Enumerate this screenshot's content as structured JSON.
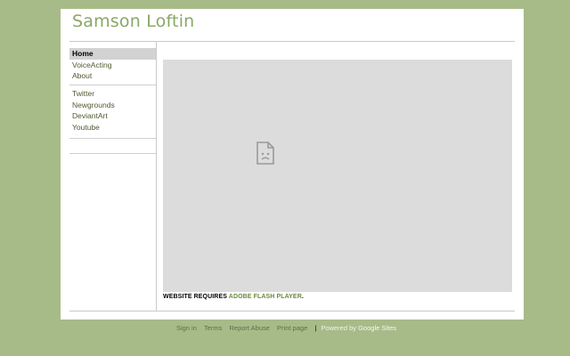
{
  "site": {
    "title": "Samson Loftin"
  },
  "sidebar": {
    "primary": [
      {
        "label": "Home",
        "active": true
      },
      {
        "label": "VoiceActing",
        "active": false
      },
      {
        "label": "About",
        "active": false
      }
    ],
    "links": [
      {
        "label": "Twitter"
      },
      {
        "label": "Newgrounds"
      },
      {
        "label": "DeviantArt"
      },
      {
        "label": "Youtube"
      }
    ]
  },
  "main": {
    "plugin_icon": "broken-plugin-icon",
    "flash_note_prefix": "WEBSITE REQUIRES ",
    "flash_note_link": "ADOBE FLASH PLAYER",
    "flash_note_suffix": "."
  },
  "footer": {
    "links": [
      "Sign in",
      "Terms",
      "Report Abuse",
      "Print page"
    ],
    "separator": "|",
    "powered_by": "Powered by",
    "powered_link": "Google Sites"
  },
  "colors": {
    "background": "#a7bb88",
    "title": "#8aa766",
    "link": "#6b8a3c"
  }
}
